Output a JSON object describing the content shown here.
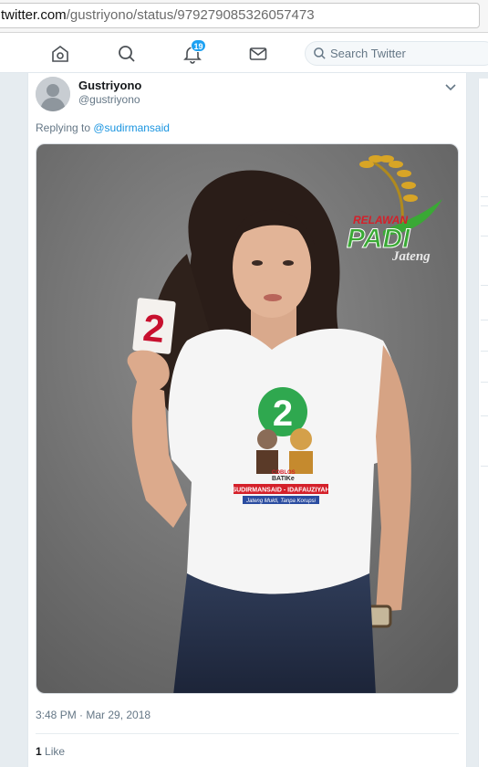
{
  "browser": {
    "url_host": "twitter.com",
    "url_path": "/gustriyono/status/979279085326057473"
  },
  "nav": {
    "items": [
      {
        "icon": "home-icon"
      },
      {
        "icon": "explore-icon"
      },
      {
        "icon": "notifications-icon"
      },
      {
        "icon": "messages-icon"
      }
    ],
    "notification_count": "19",
    "search_placeholder": "Search Twitter"
  },
  "tweet": {
    "display_name": "Gustriyono",
    "screen_name": "@gustriyono",
    "replying_prefix": "Replying to ",
    "replying_to": "@sudirmansaid",
    "timestamp": "3:48 PM · Mar 29, 2018",
    "like_count": "1",
    "like_label": "Like"
  },
  "media": {
    "card_number": "2",
    "shirt_number": "2",
    "logo_line1": "RELAWAN",
    "logo_line2": "PADI",
    "logo_line3": "Jateng",
    "shirt_small": "COBLOS",
    "shirt_batik": "BATIKe",
    "shirt_names": "SUDIRMANSAID - IDAFAUZIYAH",
    "shirt_slogan": "Jateng Mukti, Tanpa Korupsi",
    "colors": {
      "accent": "#1da1f2",
      "link": "#1b95e0",
      "logo_green": "#3aa935",
      "logo_red": "#d4202a",
      "shirt_number_green": "#2fa84f"
    }
  }
}
